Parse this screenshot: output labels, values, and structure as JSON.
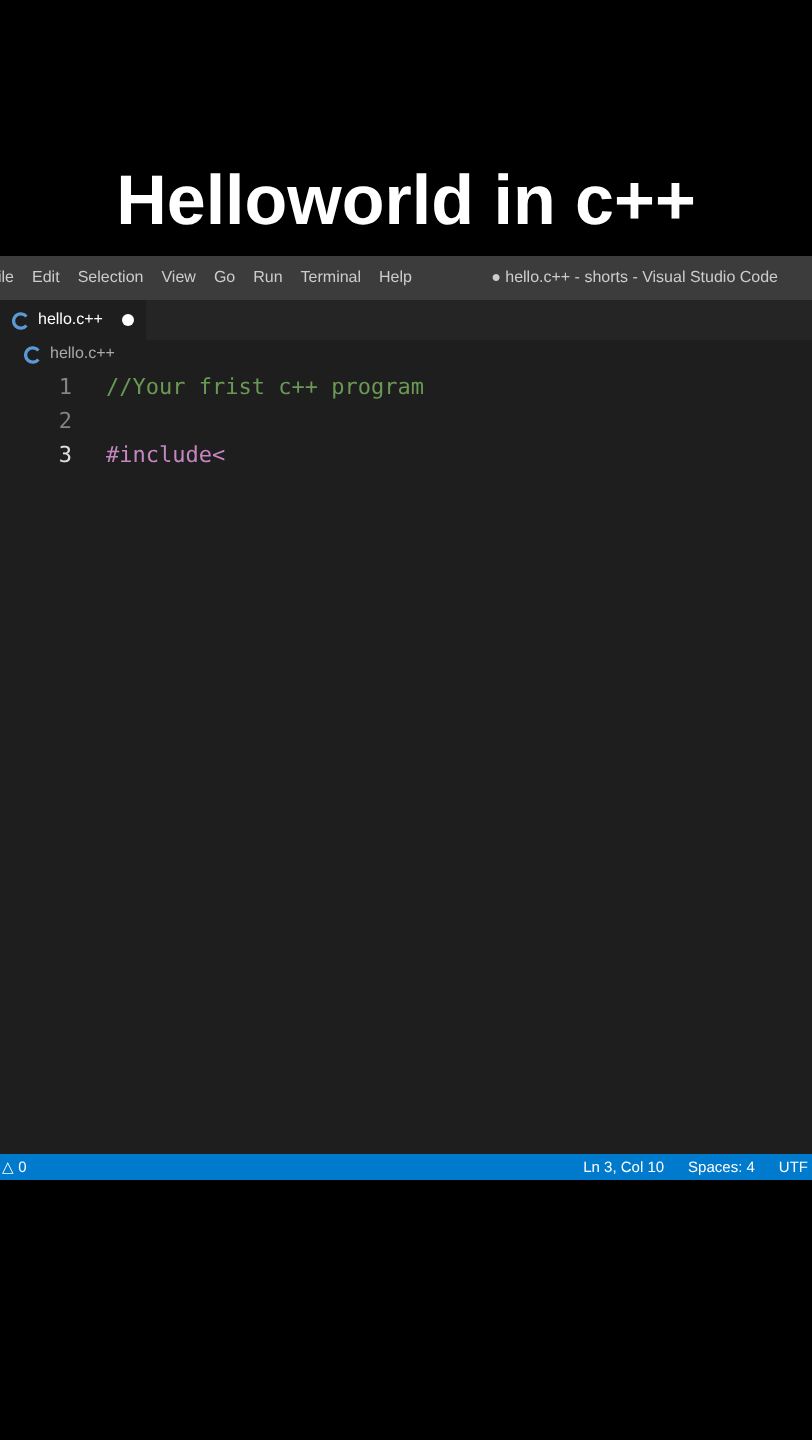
{
  "caption": "Helloworld in c++",
  "menu": [
    "ile",
    "Edit",
    "Selection",
    "View",
    "Go",
    "Run",
    "Terminal",
    "Help"
  ],
  "window": {
    "title": "● hello.c++ - shorts - Visual Studio Code"
  },
  "tabs": [
    {
      "label": "hello.c++",
      "selected": true,
      "modified": true
    }
  ],
  "breadcrumb": "hello.c++",
  "lines": [
    {
      "number": "1",
      "active": false,
      "tokens": [
        {
          "kind": "comment",
          "text": "//Your frist c++ program"
        }
      ]
    },
    {
      "number": "2",
      "active": false
    },
    {
      "number": "3",
      "active": true,
      "tokens": [
        {
          "kind": "directive",
          "text": "#include<"
        }
      ]
    }
  ],
  "status_bar": {
    "left": "△ 0",
    "right": [
      "Ln 3, Col 10",
      "Spaces: 4",
      "UTF"
    ]
  }
}
